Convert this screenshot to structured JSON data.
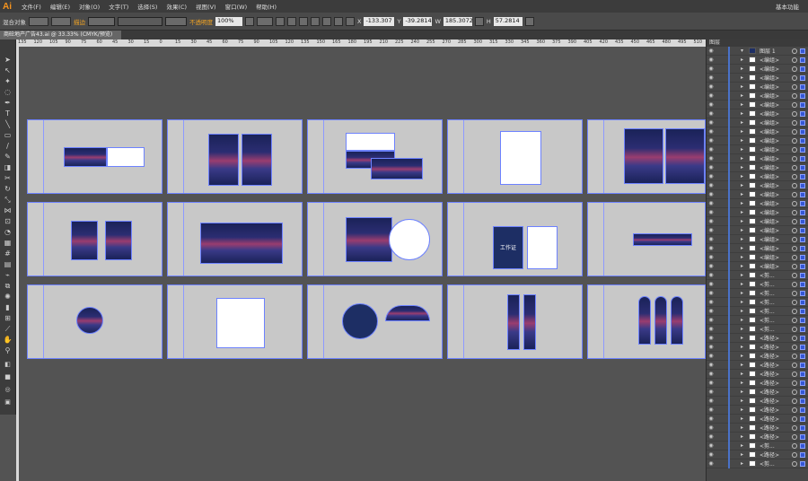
{
  "app": {
    "logo": "Ai",
    "workspace": "基本功能"
  },
  "menu": [
    "文件(F)",
    "编辑(E)",
    "对象(O)",
    "文字(T)",
    "选择(S)",
    "效果(C)",
    "视图(V)",
    "窗口(W)",
    "帮助(H)"
  ],
  "control": {
    "selection": "混合对象",
    "stroke_label": "描边",
    "opacity_label": "不透明度",
    "opacity_value": "100%",
    "x_value": "-133.307",
    "y_value": "-39.2814",
    "w_value": "185.3072",
    "h_value": "57.2814"
  },
  "document": {
    "tab": "商砼地产广告43.ai @ 33.33% (CMYK/预览)"
  },
  "ruler": [
    "135",
    "120",
    "105",
    "90",
    "75",
    "60",
    "45",
    "30",
    "15",
    "0",
    "15",
    "30",
    "45",
    "60",
    "75",
    "90",
    "105",
    "120",
    "135",
    "150",
    "165",
    "180",
    "195",
    "210",
    "225",
    "240",
    "255",
    "270",
    "285",
    "300",
    "315",
    "330",
    "345",
    "360",
    "375",
    "390",
    "405",
    "420",
    "435",
    "450",
    "465",
    "480",
    "495",
    "510"
  ],
  "layers": {
    "panel_title": "图层",
    "rows": [
      {
        "name": "图层 1",
        "thumb": "#1d2e64"
      },
      {
        "name": "<编组>"
      },
      {
        "name": "<编组>"
      },
      {
        "name": "<编组>"
      },
      {
        "name": "<编组>"
      },
      {
        "name": "<编组>"
      },
      {
        "name": "<编组>"
      },
      {
        "name": "<编组>"
      },
      {
        "name": "<编组>"
      },
      {
        "name": "<编组>"
      },
      {
        "name": "<编组>"
      },
      {
        "name": "<编组>"
      },
      {
        "name": "<编组>"
      },
      {
        "name": "<编组>"
      },
      {
        "name": "<编组>"
      },
      {
        "name": "<编组>"
      },
      {
        "name": "<编组>"
      },
      {
        "name": "<编组>"
      },
      {
        "name": "<编组>"
      },
      {
        "name": "<编组>"
      },
      {
        "name": "<编组>"
      },
      {
        "name": "<编组>"
      },
      {
        "name": "<编组>"
      },
      {
        "name": "<编组>"
      },
      {
        "name": "<编组>"
      },
      {
        "name": "<剪..."
      },
      {
        "name": "<剪..."
      },
      {
        "name": "<剪..."
      },
      {
        "name": "<剪..."
      },
      {
        "name": "<剪..."
      },
      {
        "name": "<剪..."
      },
      {
        "name": "<剪..."
      },
      {
        "name": "<路径>"
      },
      {
        "name": "<路径>"
      },
      {
        "name": "<路径>"
      },
      {
        "name": "<路径>"
      },
      {
        "name": "<路径>"
      },
      {
        "name": "<路径>"
      },
      {
        "name": "<路径>"
      },
      {
        "name": "<路径>"
      },
      {
        "name": "<路径>"
      },
      {
        "name": "<路径>"
      },
      {
        "name": "<路径>"
      },
      {
        "name": "<路径>"
      },
      {
        "name": "<剪..."
      },
      {
        "name": "<路径>"
      },
      {
        "name": "<剪..."
      }
    ]
  },
  "artboard_labels": {
    "badge": "工作证"
  },
  "colors": {
    "accent": "#6d82ff",
    "navy": "#1d2e64",
    "pink": "#9a3d6f",
    "ai_orange": "#f7941d"
  }
}
